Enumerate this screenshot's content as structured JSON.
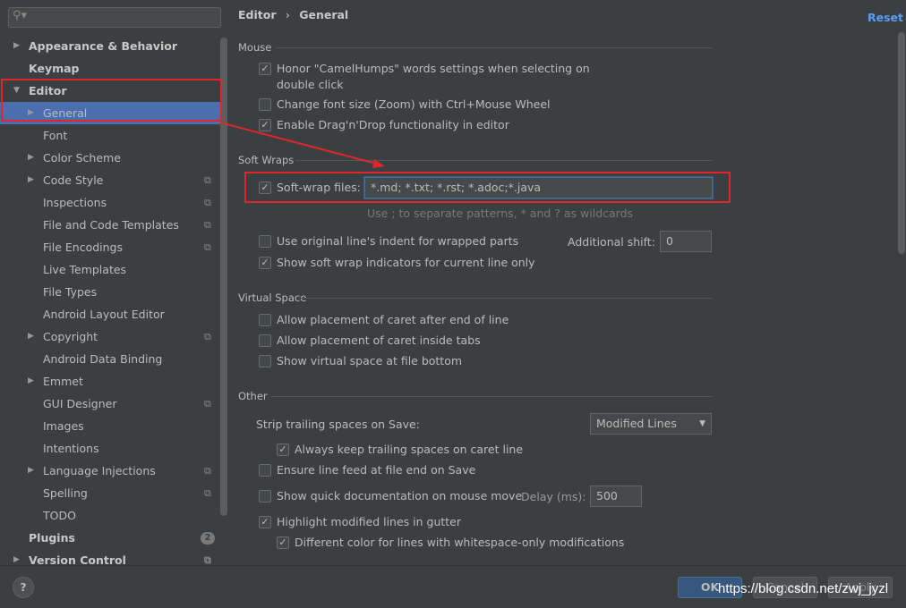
{
  "sidebar": {
    "search_placeholder": "",
    "items": [
      {
        "label": "Appearance & Behavior",
        "level": 0,
        "arrow": "right",
        "bold": true
      },
      {
        "label": "Keymap",
        "level": 0,
        "bold": true
      },
      {
        "label": "Editor",
        "level": 0,
        "arrow": "down",
        "bold": true
      },
      {
        "label": "General",
        "level": 1,
        "arrow": "right",
        "selected": true
      },
      {
        "label": "Font",
        "level": 1
      },
      {
        "label": "Color Scheme",
        "level": 1,
        "arrow": "right"
      },
      {
        "label": "Code Style",
        "level": 1,
        "arrow": "right",
        "copy": true
      },
      {
        "label": "Inspections",
        "level": 1,
        "copy": true
      },
      {
        "label": "File and Code Templates",
        "level": 1,
        "copy": true
      },
      {
        "label": "File Encodings",
        "level": 1,
        "copy": true
      },
      {
        "label": "Live Templates",
        "level": 1
      },
      {
        "label": "File Types",
        "level": 1
      },
      {
        "label": "Android Layout Editor",
        "level": 1
      },
      {
        "label": "Copyright",
        "level": 1,
        "arrow": "right",
        "copy": true
      },
      {
        "label": "Android Data Binding",
        "level": 1
      },
      {
        "label": "Emmet",
        "level": 1,
        "arrow": "right"
      },
      {
        "label": "GUI Designer",
        "level": 1,
        "copy": true
      },
      {
        "label": "Images",
        "level": 1
      },
      {
        "label": "Intentions",
        "level": 1
      },
      {
        "label": "Language Injections",
        "level": 1,
        "arrow": "right",
        "copy": true
      },
      {
        "label": "Spelling",
        "level": 1,
        "copy": true
      },
      {
        "label": "TODO",
        "level": 1
      },
      {
        "label": "Plugins",
        "level": 0,
        "bold": true,
        "badge": "2"
      },
      {
        "label": "Version Control",
        "level": 0,
        "arrow": "right",
        "bold": true,
        "copy": true
      }
    ]
  },
  "header": {
    "breadcrumb": [
      "Editor",
      "General"
    ],
    "sep": "›",
    "reset": "Reset"
  },
  "sections": {
    "mouse": "Mouse",
    "soft_wraps": "Soft Wraps",
    "virtual_space": "Virtual Space",
    "other": "Other"
  },
  "options": {
    "camel1": "Honor \"CamelHumps\" words settings when selecting on",
    "camel2": "double click",
    "zoom": "Change font size (Zoom) with Ctrl+Mouse Wheel",
    "dnd": "Enable Drag'n'Drop functionality in editor",
    "softwrap_label": "Soft-wrap files:",
    "softwrap_value": "*.md; *.txt; *.rst; *.adoc;*.java",
    "softwrap_hint": "Use ; to separate patterns, * and ? as wildcards",
    "indent": "Use original line's indent for wrapped parts",
    "shift_label": "Additional shift:",
    "shift_value": "0",
    "indicators": "Show soft wrap indicators for current line only",
    "caret_end": "Allow placement of caret after end of line",
    "caret_tabs": "Allow placement of caret inside tabs",
    "virtual_bottom": "Show virtual space at file bottom",
    "strip_label": "Strip trailing spaces on Save:",
    "strip_value": "Modified Lines",
    "keep_trailing": "Always keep trailing spaces on caret line",
    "line_feed": "Ensure line feed at file end on Save",
    "quick_doc": "Show quick documentation on mouse move",
    "delay_label": "Delay (ms):",
    "delay_value": "500",
    "highlight": "Highlight modified lines in gutter",
    "diff_color": "Different color for lines with whitespace-only modifications"
  },
  "checked": {
    "camel": true,
    "zoom": false,
    "dnd": true,
    "softwrap": true,
    "indent": false,
    "indicators": true,
    "caret_end": false,
    "caret_tabs": false,
    "virtual_bottom": false,
    "keep_trailing": true,
    "line_feed": false,
    "quick_doc": false,
    "highlight": true,
    "diff_color": true
  },
  "footer": {
    "help": "?",
    "ok": "OK",
    "cancel": "Cancel",
    "apply": "Apply",
    "watermark": "https://blog.csdn.net/zwj_jyzl"
  },
  "colors": {
    "accent": "#4b6eaf",
    "link": "#589df6",
    "annotation": "#e0262a"
  }
}
